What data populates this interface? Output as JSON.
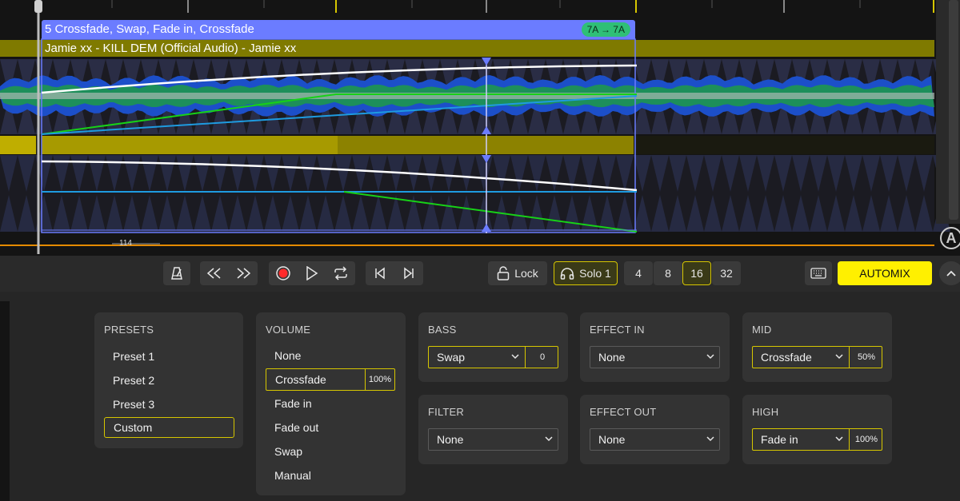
{
  "timeline": {
    "clip_header": "5 Crossfade, Swap, Fade in, Crossfade",
    "key_badge": "7A → 7A",
    "track_title": "Jamie xx - KILL DEM (Official Audio) - Jamie xx",
    "bpm_marker": "114",
    "logo_letter": "A",
    "colors": {
      "clip": "#6b7cff",
      "track": "#7f7a00",
      "waveform_blue": "#1c4fc9",
      "waveform_green": "#1d8f5a",
      "white_curve": "#ffffff",
      "green_curve": "#17d117",
      "cyan_curve": "#1e9be0"
    }
  },
  "toolbar": {
    "metronome_icon": "metronome-icon",
    "rewind_icon": "rewind-icon",
    "forward_icon": "fast-forward-icon",
    "record_icon": "record-icon",
    "play_icon": "play-icon",
    "loop_icon": "loop-icon",
    "prev_icon": "skip-previous-icon",
    "next_icon": "skip-next-icon",
    "lock_label": "Lock",
    "solo_label": "Solo 1",
    "beats": [
      "4",
      "8",
      "16",
      "32"
    ],
    "beats_selected": "16",
    "keyboard_icon": "keyboard-icon",
    "automix_label": "AUTOMIX",
    "collapse_icon": "chevron-up-icon"
  },
  "presets": {
    "title": "PRESETS",
    "items": [
      "Preset 1",
      "Preset 2",
      "Preset 3",
      "Custom"
    ],
    "selected": "Custom"
  },
  "volume": {
    "title": "VOLUME",
    "items": [
      "None",
      "Crossfade",
      "Fade in",
      "Fade out",
      "Swap",
      "Manual"
    ],
    "selected": "Crossfade",
    "selected_value": "100%"
  },
  "bass": {
    "title": "BASS",
    "value": "Swap",
    "amount": "0"
  },
  "effect_in": {
    "title": "EFFECT IN",
    "value": "None"
  },
  "mid": {
    "title": "MID",
    "value": "Crossfade",
    "amount": "50%"
  },
  "filter": {
    "title": "FILTER",
    "value": "None"
  },
  "effect_out": {
    "title": "EFFECT OUT",
    "value": "None"
  },
  "high": {
    "title": "HIGH",
    "value": "Fade in",
    "amount": "100%"
  }
}
